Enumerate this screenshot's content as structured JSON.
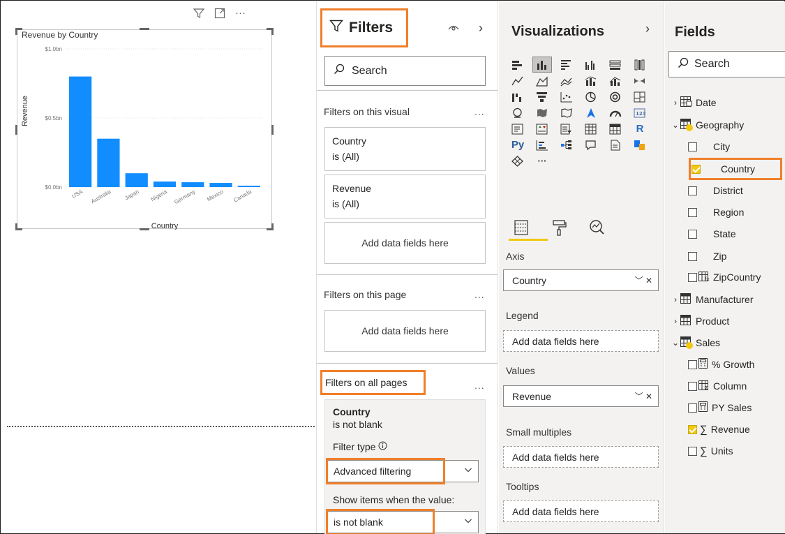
{
  "canvas": {
    "header_icons": [
      "filter-icon",
      "focus-mode-icon",
      "more-options-icon"
    ],
    "more": "···"
  },
  "chart_data": {
    "type": "bar",
    "title": "Revenue by Country",
    "xlabel": "Country",
    "ylabel": "Revenue",
    "y_ticks": [
      "$1.0bn",
      "$0.5bn",
      "$0.0bn"
    ],
    "ylim": [
      0,
      1.0
    ],
    "categories": [
      "USA",
      "Australia",
      "Japan",
      "Nigeria",
      "Germany",
      "Mexico",
      "Canada"
    ],
    "values": [
      0.8,
      0.35,
      0.1,
      0.04,
      0.035,
      0.03,
      0.01
    ],
    "bar_color": "#118dff",
    "grid": true
  },
  "filters": {
    "title": "Filters",
    "search_placeholder": "Search",
    "on_visual_label": "Filters on this visual",
    "on_page_label": "Filters on this page",
    "all_pages_label": "Filters on all pages",
    "more": "...",
    "visual_cards": [
      {
        "field": "Country",
        "state": "is (All)"
      },
      {
        "field": "Revenue",
        "state": "is (All)"
      }
    ],
    "add_fields": "Add data fields here",
    "all_pages_card": {
      "field": "Country",
      "state": "is not blank",
      "filter_type_label": "Filter type",
      "filter_type_value": "Advanced filtering",
      "show_items_label": "Show items when the value:",
      "condition_value": "is not blank"
    }
  },
  "visualizations": {
    "title": "Visualizations",
    "r_label": "R",
    "py_label": "Py",
    "more": "···",
    "axis_label": "Axis",
    "axis_value": "Country",
    "legend_label": "Legend",
    "values_label": "Values",
    "values_value": "Revenue",
    "small_multiples_label": "Small multiples",
    "tooltips_label": "Tooltips",
    "add_fields": "Add data fields here"
  },
  "fields": {
    "title": "Fields",
    "search_placeholder": "Search",
    "tables": {
      "date": "Date",
      "geography": "Geography",
      "manufacturer": "Manufacturer",
      "product": "Product",
      "sales": "Sales"
    },
    "geography_fields": [
      "City",
      "Country",
      "District",
      "Region",
      "State",
      "Zip",
      "ZipCountry"
    ],
    "sales_fields": [
      "% Growth",
      "Column",
      "PY Sales",
      "Revenue",
      "Units"
    ],
    "accent": "#f2c811",
    "highlight": "#f07f2a"
  }
}
